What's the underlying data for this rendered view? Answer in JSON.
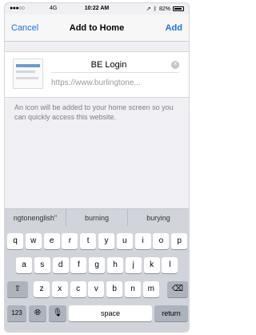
{
  "status_bar": {
    "carrier": "●●●○○",
    "network": "4G",
    "time": "10:22 AM",
    "battery": "82%"
  },
  "nav": {
    "cancel": "Cancel",
    "title": "Add to Home",
    "add": "Add"
  },
  "bookmark": {
    "name": "BE Login",
    "url": "https://www.burlingtone..."
  },
  "description": "An icon will be added to your home screen so you can quickly access this website.",
  "suggestions": [
    "ngtonenglish\"",
    "burning",
    "burying"
  ],
  "keyboard": {
    "row1": [
      "q",
      "w",
      "e",
      "r",
      "t",
      "y",
      "u",
      "i",
      "o",
      "p"
    ],
    "row2": [
      "a",
      "s",
      "d",
      "f",
      "g",
      "h",
      "j",
      "k",
      "l"
    ],
    "row3": [
      "z",
      "x",
      "c",
      "v",
      "b",
      "n",
      "m"
    ],
    "numbers": "123",
    "space": "space",
    "return": "return"
  }
}
